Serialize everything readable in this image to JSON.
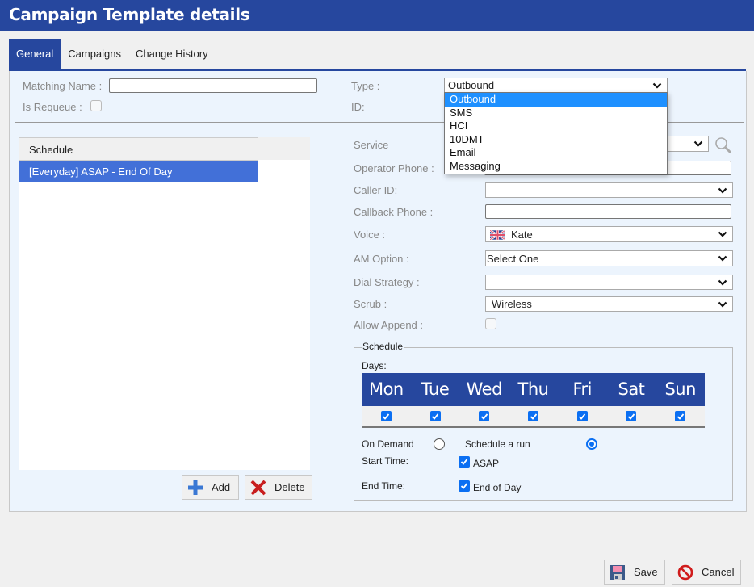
{
  "window": {
    "title": "Campaign Template details"
  },
  "tabs": [
    {
      "label": "General",
      "active": true
    },
    {
      "label": "Campaigns",
      "active": false
    },
    {
      "label": "Change History",
      "active": false
    }
  ],
  "form": {
    "matching_name": {
      "label": "Matching Name :",
      "value": ""
    },
    "is_requeue": {
      "label": "Is Requeue :",
      "checked": false
    },
    "type": {
      "label": "Type :",
      "value": "Outbound",
      "options": [
        "Outbound",
        "SMS",
        "HCI",
        "10DMT",
        "Email",
        "Messaging"
      ],
      "highlighted": "Outbound"
    },
    "id": {
      "label": "ID:",
      "value": ""
    },
    "service": {
      "label": "Service",
      "value": ""
    },
    "operator_phone": {
      "label": "Operator Phone :",
      "value": ""
    },
    "caller_id": {
      "label": "Caller ID:",
      "value": ""
    },
    "callback_phone": {
      "label": "Callback Phone :",
      "value": ""
    },
    "voice": {
      "label": "Voice :",
      "value": "Kate",
      "flag": "uk-flag"
    },
    "am_option": {
      "label": "AM Option :",
      "value": "Select One"
    },
    "dial_strategy": {
      "label": "Dial Strategy :",
      "value": ""
    },
    "scrub": {
      "label": "Scrub :",
      "value": "Wireless"
    },
    "allow_append": {
      "label": "Allow Append :",
      "checked": false
    }
  },
  "schedule_list": {
    "header": "Schedule",
    "rows": [
      {
        "label": "[Everyday] ASAP - End Of Day",
        "selected": true
      }
    ],
    "add_label": "Add",
    "delete_label": "Delete"
  },
  "schedule": {
    "legend": "Schedule",
    "days_label": "Days:",
    "days": [
      {
        "label": "Mon",
        "checked": true
      },
      {
        "label": "Tue",
        "checked": true
      },
      {
        "label": "Wed",
        "checked": true
      },
      {
        "label": "Thu",
        "checked": true
      },
      {
        "label": "Fri",
        "checked": true
      },
      {
        "label": "Sat",
        "checked": true
      },
      {
        "label": "Sun",
        "checked": true
      }
    ],
    "on_demand_label": "On Demand",
    "on_demand_selected": false,
    "schedule_run_label": "Schedule a run",
    "schedule_run_selected": true,
    "start_time_label": "Start Time:",
    "start_asap_label": "ASAP",
    "start_asap_checked": true,
    "end_time_label": "End Time:",
    "end_of_day_label": "End of Day",
    "end_of_day_checked": true
  },
  "footer": {
    "save_label": "Save",
    "cancel_label": "Cancel"
  },
  "colors": {
    "brand": "#26479e",
    "selected_row": "#4270d8",
    "dropdown_highlight": "#1e90ff",
    "checkbox": "#0b6ff2"
  }
}
